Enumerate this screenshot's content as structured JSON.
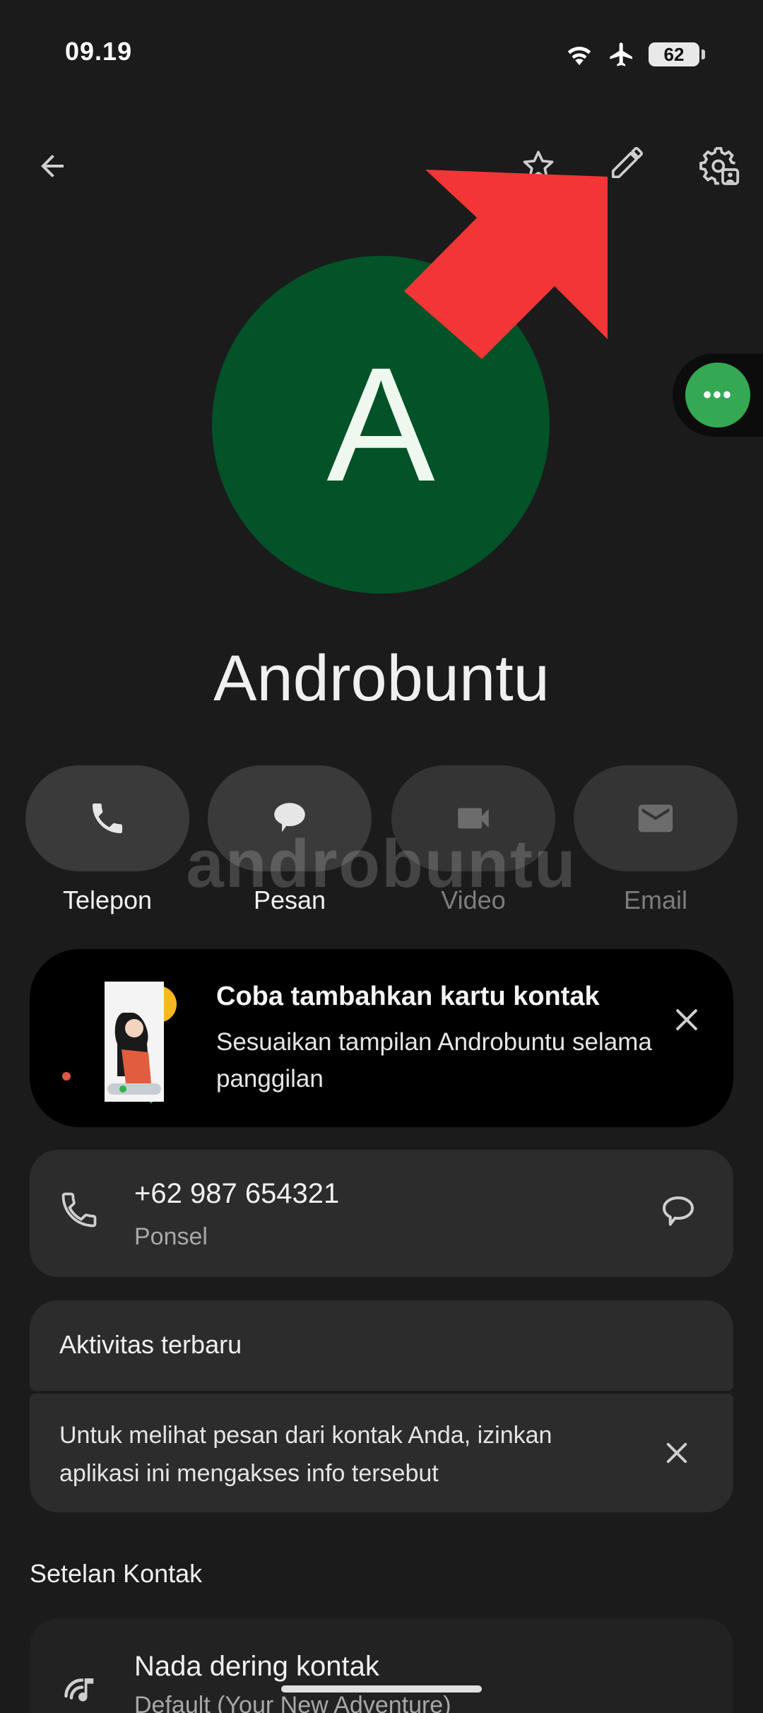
{
  "status_bar": {
    "time": "09.19",
    "battery_level": "62"
  },
  "top_bar": {
    "icons": [
      "back-arrow-icon",
      "star-icon",
      "edit-pencil-icon",
      "contact-settings-icon"
    ]
  },
  "contact": {
    "initial": "A",
    "name": "Androbuntu",
    "avatar_color": "#035228"
  },
  "actions": [
    {
      "label": "Telepon",
      "icon": "phone-icon",
      "enabled": true
    },
    {
      "label": "Pesan",
      "icon": "message-icon",
      "enabled": true
    },
    {
      "label": "Video",
      "icon": "video-icon",
      "enabled": false
    },
    {
      "label": "Email",
      "icon": "email-icon",
      "enabled": false
    }
  ],
  "watermark": "androbuntu",
  "promo": {
    "title": "Coba tambahkan kartu kontak",
    "body": "Sesuaikan tampilan Androbuntu selama panggilan"
  },
  "phone": {
    "number": "+62 987 654321",
    "type": "Ponsel"
  },
  "activity": {
    "title": "Aktivitas terbaru",
    "permission_text": "Untuk melihat pesan dari kontak Anda, izinkan aplikasi ini mengakses info tersebut"
  },
  "settings": {
    "heading": "Setelan Kontak",
    "ringtone_title": "Nada dering kontak",
    "ringtone_value": "Default (Your New Adventure)"
  },
  "colors": {
    "background": "#1b1b1b",
    "accent_green": "#34a853",
    "annotation_red": "#f23535"
  }
}
